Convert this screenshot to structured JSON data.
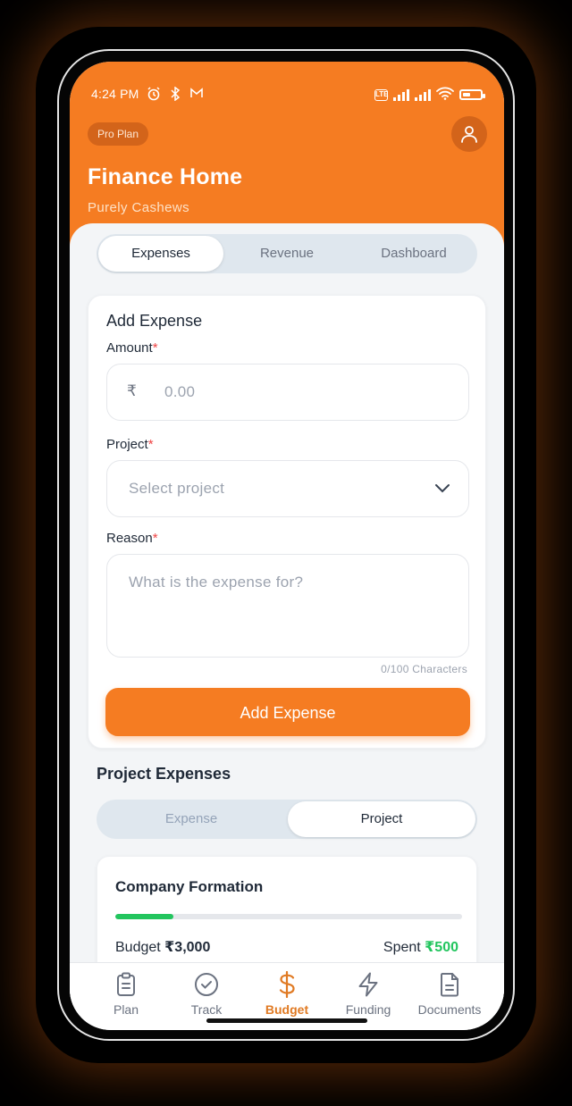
{
  "status_bar": {
    "time": "4:24 PM",
    "indicators": [
      "alarm-icon",
      "bluetooth-icon",
      "gmail-icon"
    ],
    "battery_text": "37",
    "sim_text": "VoLTE"
  },
  "header": {
    "badge": "Pro Plan",
    "title": "Finance Home",
    "subtitle": "Purely Cashews",
    "accent_color": "#f57c22"
  },
  "tabs": [
    {
      "label": "Expenses",
      "active": true
    },
    {
      "label": "Revenue",
      "active": false
    },
    {
      "label": "Dashboard",
      "active": false
    }
  ],
  "form": {
    "title": "Add Expense",
    "amount": {
      "label": "Amount",
      "required": "*",
      "currency": "₹",
      "placeholder": "0.00"
    },
    "project": {
      "label": "Project",
      "required": "*",
      "placeholder": "Select project"
    },
    "reason": {
      "label": "Reason",
      "required": "*",
      "placeholder": "What is the expense for?"
    },
    "counter": "0/100 Characters",
    "submit_label": "Add Expense"
  },
  "project_expenses": {
    "title": "Project Expenses",
    "toggle": [
      {
        "label": "Expense",
        "active": false
      },
      {
        "label": "Project",
        "active": true
      }
    ],
    "cards": [
      {
        "name": "Company Formation",
        "budget_label": "Budget",
        "budget_value": "₹3,000",
        "spent_label": "Spent",
        "spent_value": "₹500",
        "progress": 0.167
      }
    ]
  },
  "bottom_nav": [
    {
      "label": "Plan",
      "icon": "clipboard-icon",
      "active": false
    },
    {
      "label": "Track",
      "icon": "check-circle-icon",
      "active": false
    },
    {
      "label": "Budget",
      "icon": "dollar-icon",
      "active": true
    },
    {
      "label": "Funding",
      "icon": "lightning-icon",
      "active": false
    },
    {
      "label": "Documents",
      "icon": "document-icon",
      "active": false
    }
  ]
}
